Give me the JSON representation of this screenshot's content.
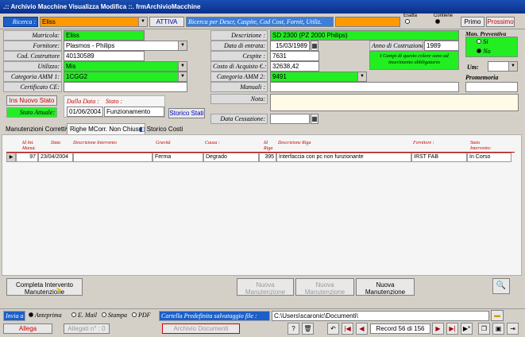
{
  "window": {
    "title": ".:: Archivio Macchine Visualizza Modifica ::.   frmArchivioMacchine"
  },
  "search": {
    "label": "Ricerca :",
    "value": "Eliss",
    "attiva": "ATTIVA",
    "placeholder_text": "Ricerca per Descr, Caspite, Cod Cost, Fornit, Utiliz.",
    "exact": "Esatta",
    "contains": "Contiene",
    "primo": "Primo",
    "prossimo": "Prossimo"
  },
  "form": {
    "matricola": {
      "label": "Matricola:",
      "value": "Eliss"
    },
    "fornitore": {
      "label": "Fornitore:",
      "value": "Plasmos - Philips"
    },
    "cod_costruttore": {
      "label": "Cod. Costruttore",
      "value": "40130589"
    },
    "utilizzo": {
      "label": "Utilizzo:",
      "value": "Mis"
    },
    "categoria_amm1": {
      "label": "Categoria AMM 1:",
      "value": "1CGG2"
    },
    "certificato_ce": {
      "label": "Certificato CE:",
      "value": ""
    },
    "descrizione": {
      "label": "Descrizione :",
      "value": "SD 2300 (PZ 2000 Philips)"
    },
    "data_entrata": {
      "label": "Data di entrata:",
      "value": "15/03/1989"
    },
    "anno_costruzione": {
      "label": "Anno di Costruzione:",
      "value": "1989"
    },
    "cespite": {
      "label": "Cespite :",
      "value": "7631"
    },
    "costo_acquisto": {
      "label": "Costo di Acquisto €.:",
      "value": "32638,42"
    },
    "categoria_amm2": {
      "label": "Categoria AMM 2:",
      "value": "9491"
    },
    "manuali": {
      "label": "Manuali :",
      "value": ""
    },
    "nota": {
      "label": "Nota:",
      "value": ""
    },
    "data_cessazione": {
      "label": "Data Cessazione:",
      "value": ""
    },
    "info_note": "I Campi di questo colore sono ad inserimento obbligatorio",
    "man_preventiva": {
      "label": "Man. Preventiva",
      "si": "Si",
      "no": "No"
    },
    "um": {
      "label": "Um:",
      "value": ""
    },
    "promemoria": {
      "label": "Promemoria",
      "value": ""
    }
  },
  "stato": {
    "ins_nuovo": "Ins Nuovo Stato",
    "attuale_label": "Stato Attuale:",
    "dalla_data_label": "Dalla Data :",
    "stato_label": "Stato :",
    "data": "01/06/2004",
    "value": "Funzionamento",
    "storico": "Storico Stati"
  },
  "tabs": [
    "Manutenzioni Correttive",
    "Righe MCorr. Non Chiuse",
    "Storico Costi"
  ],
  "table": {
    "headers": [
      "Id Int. Manut.",
      "Data",
      "Descrizione Intervento",
      "Gravità",
      "Causa :",
      "Id Riga",
      "Descrizione Riga",
      "Fornitore :",
      "Stato Intervento:"
    ],
    "rows": [
      {
        "id": "97",
        "data": "23/04/2004",
        "descr": "",
        "gravita": "Ferma",
        "causa": "Degrado",
        "id_riga": "395",
        "descr_riga": "Interfaccia con pc non funzionante",
        "fornitore": "IRST FAB",
        "stato": "In Corso"
      }
    ]
  },
  "actions": {
    "completa": "Completa Intervento Manutenzione",
    "nuova_prev": "Nuova Manutenzione Preventiva",
    "nuova_prev_km": "Nuova Manutenzione Preventiva Km o Ore",
    "nuova_corr": "Nuova Manutenzione correttiva"
  },
  "footer": {
    "invia_label": "Invia a :",
    "anteprima": "Anteprima",
    "email": "E. Mail",
    "stampa": "Stampa",
    "pdf": "PDF",
    "cartella_label": "Cartella Predefinita salvataggio file :",
    "cartella_value": "C:\\Users\\scaronic\\Documenti\\",
    "allega": "Allega Documenti",
    "allegati": "Allegati n° : 0",
    "archivio": "Archivio Documenti",
    "record": "Record 56 di 156"
  }
}
